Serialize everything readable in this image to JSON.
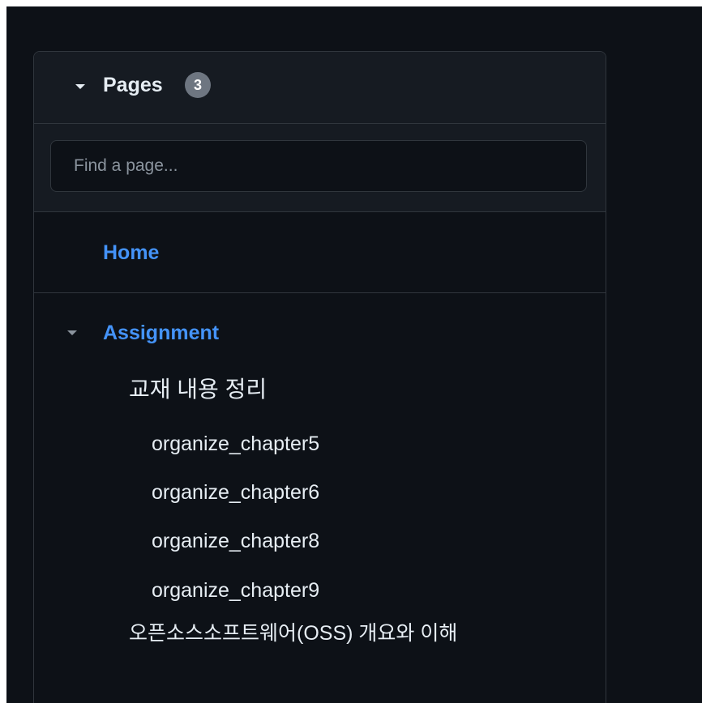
{
  "sidebar": {
    "header": {
      "title": "Pages",
      "count": "3",
      "caret_icon": "triangle-down-icon"
    },
    "search": {
      "placeholder": "Find a page...",
      "value": ""
    },
    "home": {
      "label": "Home"
    },
    "tree": {
      "caret_icon": "triangle-down-icon",
      "section_label": "Assignment",
      "items": [
        {
          "label": "교재 내용 정리",
          "level": 1
        },
        {
          "label": "organize_chapter5",
          "level": 2
        },
        {
          "label": "organize_chapter6",
          "level": 2
        },
        {
          "label": "organize_chapter8",
          "level": 2
        },
        {
          "label": "organize_chapter9",
          "level": 2
        },
        {
          "label": "오픈소스소프트웨어(OSS) 개요와 이해",
          "level": 1
        }
      ]
    }
  },
  "colors": {
    "background": "#0d1117",
    "panel_header": "#161b22",
    "border": "#30363d",
    "link": "#4493f8",
    "text": "#e6edf3",
    "muted": "#8b949e",
    "badge": "#6e7681"
  }
}
